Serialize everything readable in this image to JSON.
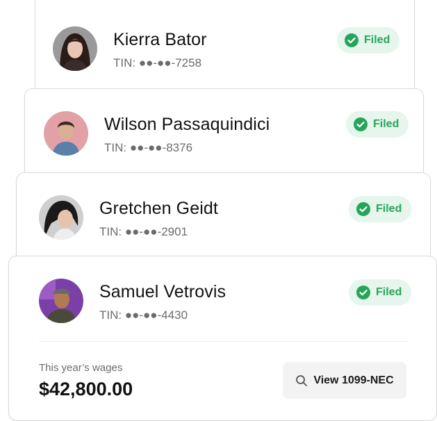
{
  "contractors": [
    {
      "name": "Kierra Bator",
      "tin": "TIN: ●●-●●-7258",
      "status": "Filed",
      "avatar": "woman-dark-hair-avatar"
    },
    {
      "name": "Wilson Passaquindici",
      "tin": "TIN: ●●-●●-8376",
      "status": "Filed",
      "avatar": "man-pink-background-avatar"
    },
    {
      "name": "Gretchen Geidt",
      "tin": "TIN: ●●-●●-2901",
      "status": "Filed",
      "avatar": "woman-black-hair-avatar"
    },
    {
      "name": "Samuel Vetrovis",
      "tin": "TIN: ●●-●●-4430",
      "status": "Filed",
      "avatar": "man-cap-purple-background-avatar"
    }
  ],
  "summary": {
    "wages_label": "This year’s wages",
    "wages_value": "$42,800.00",
    "view_button_label": "View 1099-NEC",
    "view_button_icon": "search-icon"
  },
  "colors": {
    "badge_bg": "#e6f6ec",
    "badge_text": "#25a55a",
    "card_border": "#d9d9d9"
  }
}
